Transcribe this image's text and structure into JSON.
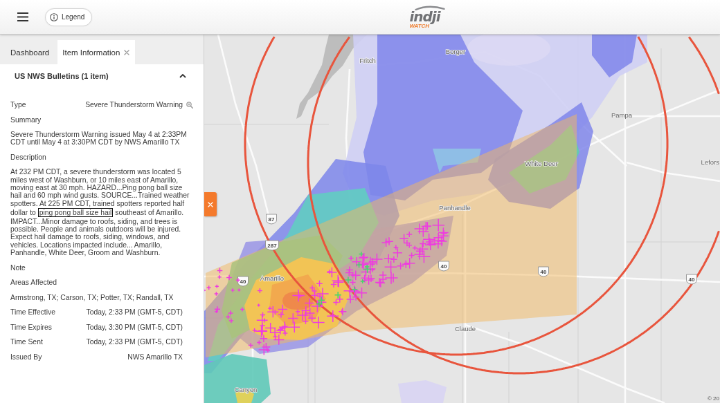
{
  "app_bar": {
    "legend_button": "Legend",
    "logo": {
      "wordmark": "indji",
      "tagline": "WATCH"
    }
  },
  "side_panel": {
    "tabs": [
      {
        "label": "Dashboard",
        "selected": false,
        "closable": false
      },
      {
        "label": "Item Information",
        "selected": true,
        "closable": true
      }
    ],
    "section": {
      "title": "US NWS Bulletins (1 item)",
      "expanded": true
    },
    "fields": [
      {
        "kind": "pair",
        "label": "Type",
        "value": "Severe Thunderstorm Warning",
        "zoomable": true
      },
      {
        "kind": "label",
        "label": "Summary"
      },
      {
        "kind": "text",
        "parts": [
          {
            "text": "Severe Thunderstorm Warning issued May 4 at 2:33PM CDT until May 4 at 3:30PM CDT by NWS Amarillo TX",
            "highlighted": false
          }
        ]
      },
      {
        "kind": "label",
        "label": "Description"
      },
      {
        "kind": "text",
        "parts": [
          {
            "text": "At 232 PM CDT, a severe thunderstorm was located 5 miles west of Washburn, or 10 miles east of Amarillo, moving east at 30 mph. HAZARD...Ping pong ball size hail and 60 mph wind gusts. SOURCE...Trained weather spotters. At 225 PM CDT, trained spotters reported half dollar to ",
            "highlighted": false
          },
          {
            "text": "ping pong ball size hail",
            "highlighted": true
          },
          {
            "text": " southeast of Amarillo. IMPACT...Minor damage to roofs, siding, and trees is possible. People and animals outdoors will be injured. Expect hail damage to roofs, siding, windows, and vehicles. Locations impacted include... Amarillo, Panhandle, White Deer, Groom and Washburn.",
            "highlighted": false
          }
        ]
      },
      {
        "kind": "label",
        "label": "Note"
      },
      {
        "kind": "label",
        "label": "Areas Affected"
      },
      {
        "kind": "text",
        "parts": [
          {
            "text": "Armstrong, TX; Carson, TX; Potter, TX; Randall, TX",
            "highlighted": false
          }
        ]
      },
      {
        "kind": "pair",
        "label": "Time Effective",
        "value": "Today, 2:33 PM (GMT-5, CDT)",
        "zoomable": false
      },
      {
        "kind": "pair",
        "label": "Time Expires",
        "value": "Today, 3:30 PM (GMT-5, CDT)",
        "zoomable": false
      },
      {
        "kind": "pair",
        "label": "Time Sent",
        "value": "Today, 2:33 PM (GMT-5, CDT)",
        "zoomable": false
      },
      {
        "kind": "pair",
        "label": "Issued By",
        "value": "NWS Amarillo TX",
        "zoomable": false
      }
    ]
  },
  "map": {
    "places": [
      "Borger",
      "Fritch",
      "Pampa",
      "White Deer",
      "Lefors",
      "Panhandle",
      "Amarillo",
      "Claude",
      "Canyon"
    ],
    "route_shields": [
      "87",
      "287",
      "40",
      "40",
      "40",
      "40"
    ],
    "attribution": "© 20"
  }
}
